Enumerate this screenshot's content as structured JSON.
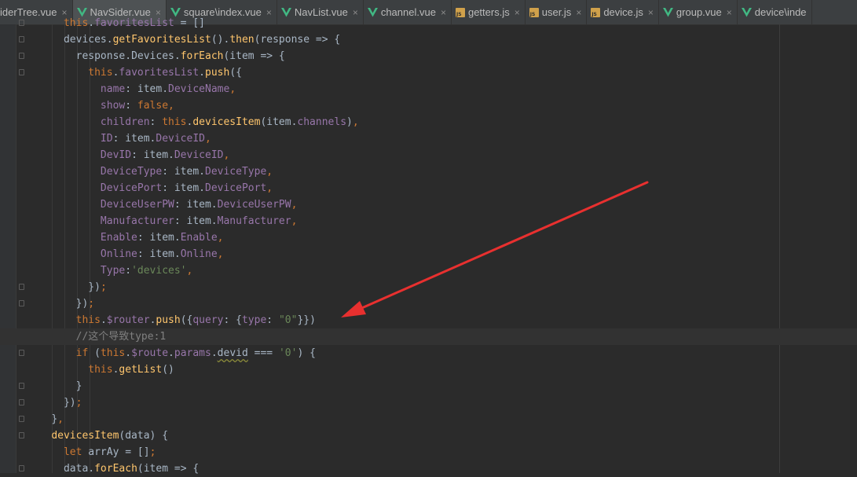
{
  "tabs": [
    {
      "name": "iderTree.vue",
      "type": "vue",
      "active": false
    },
    {
      "name": "NavSider.vue",
      "type": "vue",
      "active": true
    },
    {
      "name": "square\\index.vue",
      "type": "vue",
      "active": false
    },
    {
      "name": "NavList.vue",
      "type": "vue",
      "active": false
    },
    {
      "name": "channel.vue",
      "type": "vue",
      "active": false
    },
    {
      "name": "getters.js",
      "type": "js",
      "active": false
    },
    {
      "name": "user.js",
      "type": "js",
      "active": false
    },
    {
      "name": "device.js",
      "type": "js",
      "active": false
    },
    {
      "name": "group.vue",
      "type": "vue",
      "active": false
    },
    {
      "name": "device\\inde",
      "type": "vue",
      "active": false
    }
  ],
  "close_glyph": "×",
  "current_line_index": 19,
  "colors": {
    "vue_green": "#41b883",
    "keyword": "#cc7832",
    "function": "#ffc66d",
    "property": "#9876aa",
    "string": "#6a8759",
    "comment": "#808080",
    "annotation_arrow": "#e8302f"
  },
  "code_lines": [
    {
      "indent": 10,
      "fold": true,
      "tokens": [
        [
          "kw",
          "this"
        ],
        [
          "plain",
          "."
        ],
        [
          "prop",
          "favoritesList"
        ],
        [
          "plain",
          " = []"
        ]
      ]
    },
    {
      "indent": 10,
      "fold": true,
      "tokens": [
        [
          "plain",
          "devices."
        ],
        [
          "fn",
          "getFavoritesList"
        ],
        [
          "plain",
          "()."
        ],
        [
          "fn",
          "then"
        ],
        [
          "plain",
          "(response => {"
        ]
      ]
    },
    {
      "indent": 12,
      "fold": true,
      "tokens": [
        [
          "plain",
          "response.Devices."
        ],
        [
          "fn",
          "forEach"
        ],
        [
          "plain",
          "(item => {"
        ]
      ]
    },
    {
      "indent": 14,
      "fold": true,
      "tokens": [
        [
          "kw",
          "this"
        ],
        [
          "plain",
          "."
        ],
        [
          "prop",
          "favoritesList"
        ],
        [
          "plain",
          "."
        ],
        [
          "fn",
          "push"
        ],
        [
          "plain",
          "({"
        ]
      ]
    },
    {
      "indent": 16,
      "fold": false,
      "tokens": [
        [
          "prop",
          "name"
        ],
        [
          "plain",
          ": item."
        ],
        [
          "prop",
          "DeviceName"
        ],
        [
          "kw",
          ","
        ]
      ]
    },
    {
      "indent": 16,
      "fold": false,
      "tokens": [
        [
          "prop",
          "show"
        ],
        [
          "plain",
          ": "
        ],
        [
          "kw",
          "false"
        ],
        [
          "kw",
          ","
        ]
      ]
    },
    {
      "indent": 16,
      "fold": false,
      "tokens": [
        [
          "prop",
          "children"
        ],
        [
          "plain",
          ": "
        ],
        [
          "kw",
          "this"
        ],
        [
          "plain",
          "."
        ],
        [
          "fn",
          "devicesItem"
        ],
        [
          "plain",
          "(item."
        ],
        [
          "prop",
          "channels"
        ],
        [
          "plain",
          ")"
        ],
        [
          "kw",
          ","
        ]
      ]
    },
    {
      "indent": 16,
      "fold": false,
      "tokens": [
        [
          "prop",
          "ID"
        ],
        [
          "plain",
          ": item."
        ],
        [
          "prop",
          "DeviceID"
        ],
        [
          "kw",
          ","
        ]
      ]
    },
    {
      "indent": 16,
      "fold": false,
      "tokens": [
        [
          "prop",
          "DevID"
        ],
        [
          "plain",
          ": item."
        ],
        [
          "prop",
          "DeviceID"
        ],
        [
          "kw",
          ","
        ]
      ]
    },
    {
      "indent": 16,
      "fold": false,
      "tokens": [
        [
          "prop",
          "DeviceType"
        ],
        [
          "plain",
          ": item."
        ],
        [
          "prop",
          "DeviceType"
        ],
        [
          "kw",
          ","
        ]
      ]
    },
    {
      "indent": 16,
      "fold": false,
      "tokens": [
        [
          "prop",
          "DevicePort"
        ],
        [
          "plain",
          ": item."
        ],
        [
          "prop",
          "DevicePort"
        ],
        [
          "kw",
          ","
        ]
      ]
    },
    {
      "indent": 16,
      "fold": false,
      "tokens": [
        [
          "prop",
          "DeviceUserPW"
        ],
        [
          "plain",
          ": item."
        ],
        [
          "prop",
          "DeviceUserPW"
        ],
        [
          "kw",
          ","
        ]
      ]
    },
    {
      "indent": 16,
      "fold": false,
      "tokens": [
        [
          "prop",
          "Manufacturer"
        ],
        [
          "plain",
          ": item."
        ],
        [
          "prop",
          "Manufacturer"
        ],
        [
          "kw",
          ","
        ]
      ]
    },
    {
      "indent": 16,
      "fold": false,
      "tokens": [
        [
          "prop",
          "Enable"
        ],
        [
          "plain",
          ": item."
        ],
        [
          "prop",
          "Enable"
        ],
        [
          "kw",
          ","
        ]
      ]
    },
    {
      "indent": 16,
      "fold": false,
      "tokens": [
        [
          "prop",
          "Online"
        ],
        [
          "plain",
          ": item."
        ],
        [
          "prop",
          "Online"
        ],
        [
          "kw",
          ","
        ]
      ]
    },
    {
      "indent": 16,
      "fold": false,
      "tokens": [
        [
          "prop",
          "Type"
        ],
        [
          "plain",
          ":"
        ],
        [
          "str",
          "'devices'"
        ],
        [
          "kw",
          ","
        ]
      ]
    },
    {
      "indent": 14,
      "fold": true,
      "tokens": [
        [
          "plain",
          "})"
        ],
        [
          "kw",
          ";"
        ]
      ]
    },
    {
      "indent": 12,
      "fold": true,
      "tokens": [
        [
          "plain",
          "})"
        ],
        [
          "kw",
          ";"
        ]
      ]
    },
    {
      "indent": 12,
      "fold": false,
      "tokens": [
        [
          "kw",
          "this"
        ],
        [
          "plain",
          "."
        ],
        [
          "prop",
          "$router"
        ],
        [
          "plain",
          "."
        ],
        [
          "fn",
          "push"
        ],
        [
          "plain",
          "({"
        ],
        [
          "prop",
          "query"
        ],
        [
          "plain",
          ": {"
        ],
        [
          "prop",
          "type"
        ],
        [
          "plain",
          ": "
        ],
        [
          "str",
          "\"0\""
        ],
        [
          "plain",
          "}})"
        ]
      ]
    },
    {
      "indent": 12,
      "fold": false,
      "tokens": [
        [
          "cmt",
          "//这个导致type:1"
        ]
      ]
    },
    {
      "indent": 12,
      "fold": true,
      "tokens": [
        [
          "kw",
          "if "
        ],
        [
          "plain",
          "("
        ],
        [
          "kw",
          "this"
        ],
        [
          "plain",
          "."
        ],
        [
          "prop",
          "$route"
        ],
        [
          "plain",
          "."
        ],
        [
          "prop",
          "params"
        ],
        [
          "plain",
          "."
        ],
        [
          "wavy",
          "devid"
        ],
        [
          "plain",
          " === "
        ],
        [
          "str",
          "'0'"
        ],
        [
          "plain",
          ") {"
        ]
      ]
    },
    {
      "indent": 14,
      "fold": false,
      "tokens": [
        [
          "kw",
          "this"
        ],
        [
          "plain",
          "."
        ],
        [
          "fn",
          "getList"
        ],
        [
          "plain",
          "()"
        ]
      ]
    },
    {
      "indent": 12,
      "fold": true,
      "tokens": [
        [
          "plain",
          "}"
        ]
      ]
    },
    {
      "indent": 10,
      "fold": true,
      "tokens": [
        [
          "plain",
          "})"
        ],
        [
          "kw",
          ";"
        ]
      ]
    },
    {
      "indent": 8,
      "fold": true,
      "tokens": [
        [
          "plain",
          "}"
        ],
        [
          "kw",
          ","
        ]
      ]
    },
    {
      "indent": 8,
      "fold": true,
      "tokens": [
        [
          "fn",
          "devicesItem"
        ],
        [
          "plain",
          "(data) {"
        ]
      ]
    },
    {
      "indent": 10,
      "fold": false,
      "tokens": [
        [
          "kw",
          "let "
        ],
        [
          "plain",
          "arrAy = []"
        ],
        [
          "kw",
          ";"
        ]
      ]
    },
    {
      "indent": 10,
      "fold": true,
      "tokens": [
        [
          "plain",
          "data."
        ],
        [
          "fn",
          "forEach"
        ],
        [
          "plain",
          "(item => {"
        ]
      ]
    }
  ]
}
